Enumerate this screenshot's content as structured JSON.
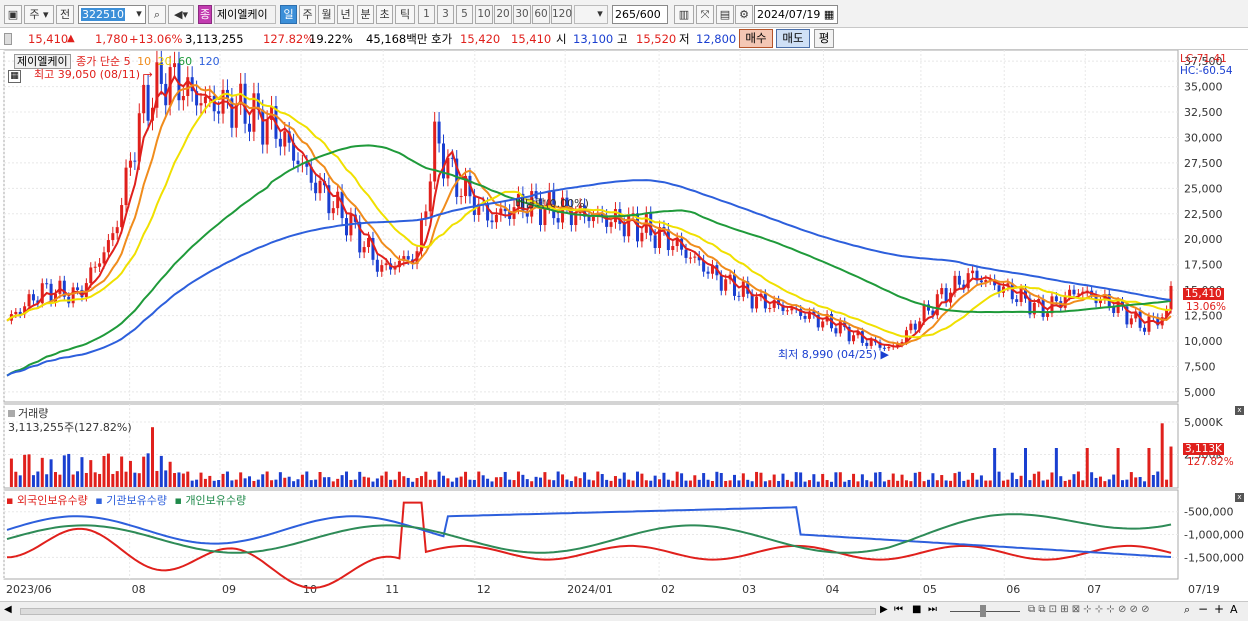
{
  "toolbar": {
    "code": "322510",
    "tab_main": "주",
    "tab_all": "전",
    "stock_name": "제이엘케이",
    "stock_badge": "종",
    "periods": [
      "일",
      "주",
      "월",
      "년",
      "분",
      "초",
      "틱"
    ],
    "selected_period": "일",
    "minute_options": [
      "1",
      "3",
      "5",
      "10",
      "20",
      "30",
      "60",
      "120"
    ],
    "count": "265",
    "count_total": "/600",
    "date": "2024/07/19"
  },
  "quote": {
    "price": "15,410",
    "change": "1,780",
    "change_pct": "+13.06%",
    "volume": "3,113,255",
    "volume_ratio": "127.82%",
    "turnover": "19.22%",
    "amount": "45,168백만",
    "ask_label": "호가",
    "ask": "15,420",
    "bid": "15,410",
    "open_label": "시",
    "open": "13,100",
    "high_label": "고",
    "high": "15,520",
    "low_label": "저",
    "low": "12,800",
    "buy_label": "매수",
    "sell_label": "매도",
    "eval_label": "평"
  },
  "price_panel": {
    "stock_label": "제이엘케이",
    "ma_label": "종가 단순",
    "ma_periods": [
      "5",
      "10",
      "20",
      "60",
      "120"
    ],
    "ma_colors": [
      "#e0201c",
      "#f08c1c",
      "#f0e000",
      "#1f9a3a",
      "#2d5fdc"
    ],
    "high_annotation": "최고 39,050 (08/11)",
    "low_annotation": "최저 8,990 (04/25)",
    "dividend_annotation": "배당락(0.00%)",
    "lc": "LC:71.41",
    "hc": "HC:-60.54",
    "current_price_tag": "15,410",
    "current_pct_tag": "13.06%",
    "y_ticks": [
      "37,500",
      "35,000",
      "32,500",
      "30,000",
      "27,500",
      "25,000",
      "22,500",
      "20,000",
      "17,500",
      "15,000",
      "12,500",
      "10,000",
      "7,500",
      "5,000"
    ]
  },
  "volume_panel": {
    "title": "거래량",
    "value": "3,113,255주(127.82%)",
    "y_ticks": [
      "5,000K",
      "2,500K"
    ],
    "current_tag": "3,113K",
    "current_pct": "127.82%"
  },
  "holder_panel": {
    "legend_foreign": "외국인보유수량",
    "legend_inst": "기관보유수량",
    "legend_indiv": "개인보유수량",
    "y_ticks": [
      "-500,000",
      "-1,000,000",
      "-1,500,000"
    ]
  },
  "x_axis": {
    "labels": [
      "2023/06",
      "08",
      "09",
      "10",
      "11",
      "12",
      "2024/01",
      "02",
      "03",
      "04",
      "05",
      "06",
      "07"
    ],
    "end_label": "07/19"
  }
}
